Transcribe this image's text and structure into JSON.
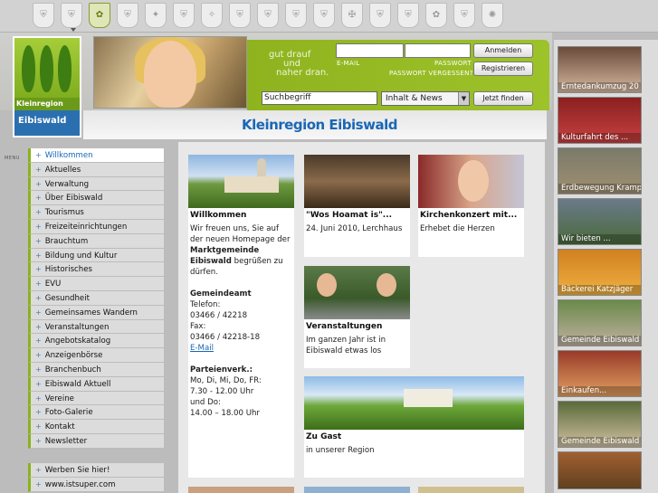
{
  "crests": [
    "c1",
    "c2",
    "c3",
    "c4",
    "c5",
    "c6",
    "c7",
    "c8",
    "c9",
    "c10",
    "c11",
    "c12",
    "c13",
    "c14",
    "c15",
    "c16",
    "c17"
  ],
  "logo": {
    "band": "Kleinregion",
    "name": "Eibiswald"
  },
  "slogan": {
    "line1": "gut drauf",
    "line2": "und",
    "line3": "naher dran."
  },
  "login": {
    "email_label": "E-MAIL",
    "password_label": "PASSWORT",
    "forgot": "PASSWORT VERGESSEN?",
    "login_button": "Anmelden",
    "register_button": "Registrieren"
  },
  "search": {
    "value": "Suchbegriff",
    "scope": "Inhalt & News",
    "button": "Jetzt finden"
  },
  "page_title": "Kleinregion Eibiswald",
  "menu_label": "MENU",
  "nav": [
    "Willkommen",
    "Aktuelles",
    "Verwaltung",
    "Über Eibiswald",
    "Tourismus",
    "Freizeiteinrichtungen",
    "Brauchtum",
    "Bildung und Kultur",
    "Historisches",
    "EVU",
    "Gesundheit",
    "Gemeinsames Wandern",
    "Veranstaltungen",
    "Angebotskatalog",
    "Anzeigenbörse",
    "Branchenbuch",
    "Eibiswald Aktuell",
    "Vereine",
    "Foto-Galerie",
    "Kontakt",
    "Newsletter"
  ],
  "nav2": [
    "Werben Sie hier!",
    "www.istsuper.com"
  ],
  "cards": {
    "welcome": {
      "title": "Willkommen",
      "text_a": "Wir freuen uns, Sie auf der neuen Homepage der",
      "text_b": "Marktgemeinde Eibiswald",
      "text_c": "begrüßen zu dürfen.",
      "office_title": "Gemeindeamt",
      "phone_label": "Telefon:",
      "phone": "03466 / 42218",
      "fax_label": "Fax:",
      "fax": "03466 / 42218-18",
      "email": "E-Mail",
      "party_title": "Parteienverk.:",
      "hours1": "Mo, Di, Mi, Do, FR:",
      "hours2": "7.30 - 12.00 Uhr",
      "hours3": "und Do:",
      "hours4": "14.00 – 18.00 Uhr"
    },
    "hoamat": {
      "title": "\"Wos Hoamat is\"...",
      "text": "24. Juni 2010, Lerchhaus"
    },
    "konzert": {
      "title": "Kirchenkonzert mit...",
      "text": "Erhebet die Herzen"
    },
    "events": {
      "title": "Veranstaltungen",
      "text": "Im ganzen Jahr ist in Eibiswald etwas los"
    },
    "guest": {
      "title": "Zu Gast",
      "text": "in unserer Region"
    }
  },
  "thumbs": [
    "Erntedankumzug 20",
    "Kulturfahrt des ...",
    "Erdbewegung Kramp",
    "Wir bieten ...",
    "Bäckerei Katzjäger",
    "Gemeinde Eibiswald",
    "Einkaufen...",
    "Gemeinde Eibiswald",
    ""
  ]
}
